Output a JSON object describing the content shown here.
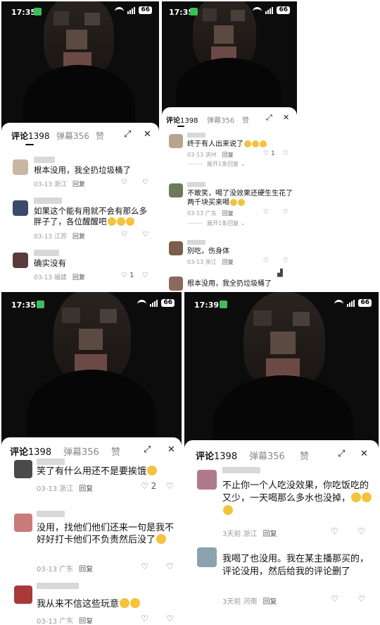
{
  "panels": [
    {
      "status": {
        "time": "17:35",
        "battery": "66"
      },
      "tabs": {
        "comments_label": "评论",
        "comments_count": "1398",
        "danmu_label": "弹幕",
        "danmu_count": "356",
        "like_label": "赞"
      },
      "comments": [
        {
          "text": "根本没用，我全扔垃圾桶了",
          "date": "03-13",
          "location": "浙江",
          "reply": "回复",
          "likes": ""
        },
        {
          "text": "如果这个能有用就不会有那么多胖子了，各位醒醒吧",
          "date": "03-13",
          "location": "江苏",
          "reply": "回复",
          "likes": ""
        },
        {
          "text": "确实没有",
          "date": "03-13",
          "location": "福建",
          "reply": "回复",
          "likes": "1"
        }
      ]
    },
    {
      "status": {
        "time": "17:35",
        "battery": "66"
      },
      "tabs": {
        "comments_label": "评论",
        "comments_count": "1398",
        "danmu_label": "弹幕",
        "danmu_count": "356",
        "like_label": "赞"
      },
      "comments": [
        {
          "text": "终于有人出来说了",
          "date": "03-13",
          "location": "滨州",
          "reply": "回复",
          "likes": "1"
        },
        {
          "text": "不敢笑，喝了没效果还硬生生花了两千块买来喝",
          "date": "03-13",
          "location": "广东",
          "reply": "回复",
          "likes": ""
        },
        {
          "text": "别吃，伤身体",
          "date": "03-13",
          "location": "浙江",
          "reply": "回复",
          "likes": ""
        },
        {
          "text": "根本没用，我全扔垃圾桶了",
          "date": "",
          "location": "",
          "reply": "",
          "likes": ""
        }
      ],
      "expand_labels": [
        "展开1条回复",
        "展开1条回复"
      ]
    },
    {
      "status": {
        "time": "17:35",
        "battery": "66"
      },
      "tabs": {
        "comments_label": "评论",
        "comments_count": "1398",
        "danmu_label": "弹幕",
        "danmu_count": "356",
        "like_label": "赞"
      },
      "comments": [
        {
          "text": "笑了有什么用还不是要挨饿",
          "date": "03-13",
          "location": "浙江",
          "reply": "回复",
          "likes": "2"
        },
        {
          "text": "没用，找他们他们还来一句是我不好好打卡他们不负责然后没了",
          "date": "03-13",
          "location": "广东",
          "reply": "回复",
          "likes": ""
        },
        {
          "text": "我从来不信这些玩意",
          "date": "03-13",
          "location": "广东",
          "reply": "回复",
          "likes": ""
        }
      ]
    },
    {
      "status": {
        "time": "17:39",
        "battery": "66"
      },
      "tabs": {
        "comments_label": "评论",
        "comments_count": "1398",
        "danmu_label": "弹幕",
        "danmu_count": "356",
        "like_label": "赞"
      },
      "comments": [
        {
          "text": "不止你一个人吃没效果，你吃饭吃的又少，一天喝那么多水也没掉，",
          "date": "3天前",
          "location": "浙江",
          "reply": "回复",
          "likes": ""
        },
        {
          "text": "我喝了也没用。我在某主播那买的，评论没用，然后给我的评论删了",
          "date": "3天前",
          "location": "河南",
          "reply": "回复",
          "likes": ""
        }
      ]
    }
  ],
  "colors": {
    "accent_green": "#3bbf5b",
    "sheet_bg": "#ffffff",
    "text": "#111111",
    "meta": "#999999"
  },
  "icons": [
    "expand-icon",
    "close-icon",
    "heart-icon",
    "dislike-icon",
    "chart-icon"
  ]
}
